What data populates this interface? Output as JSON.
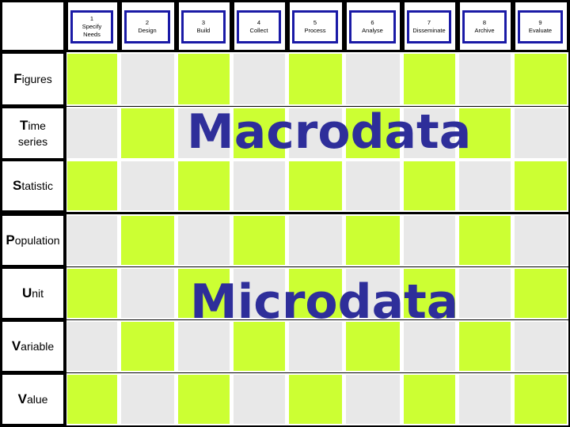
{
  "stages": [
    {
      "num": "1",
      "label": "Specify Needs"
    },
    {
      "num": "2",
      "label": "Design"
    },
    {
      "num": "3",
      "label": "Build"
    },
    {
      "num": "4",
      "label": "Collect"
    },
    {
      "num": "5",
      "label": "Process"
    },
    {
      "num": "6",
      "label": "Analyse"
    },
    {
      "num": "7",
      "label": "Disseminate"
    },
    {
      "num": "8",
      "label": "Archive"
    },
    {
      "num": "9",
      "label": "Evaluate"
    }
  ],
  "rows": [
    {
      "initial": "F",
      "rest": "igures"
    },
    {
      "initial": "T",
      "rest": "ime",
      "line2": "series"
    },
    {
      "initial": "S",
      "rest": "tatistic"
    },
    {
      "initial": "P",
      "rest": "opulation"
    },
    {
      "initial": "U",
      "rest": "nit"
    },
    {
      "initial": "V",
      "rest": "ariable"
    },
    {
      "initial": "V",
      "rest": "alue"
    }
  ],
  "overlays": {
    "macro": "Macrodata",
    "micro": "Microdata"
  },
  "colors": {
    "highlight": "#ccff33",
    "neutral": "#e8e8e8",
    "text_accent": "#2e2e9a",
    "stage_border": "#1a1aa6"
  }
}
